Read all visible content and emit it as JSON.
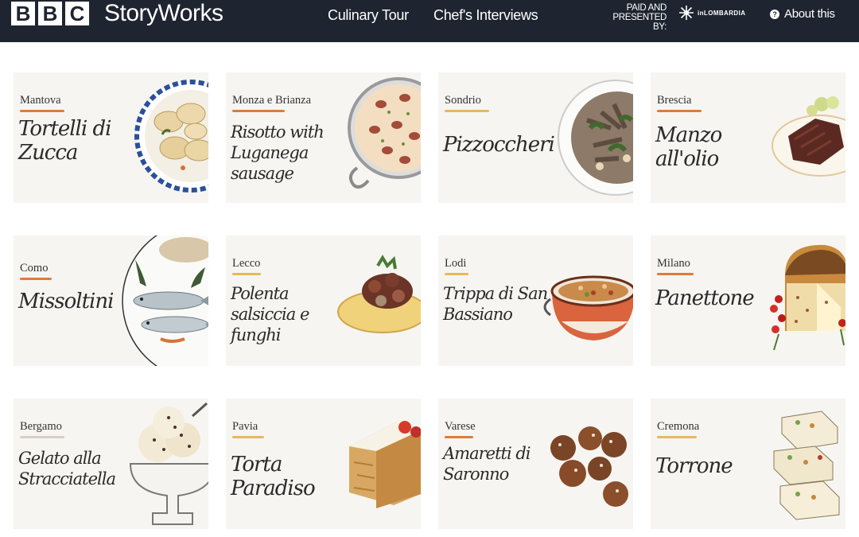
{
  "header": {
    "logo_letters": [
      "B",
      "B",
      "C"
    ],
    "brand": "StoryWorks",
    "nav": [
      "Culinary Tour",
      "Chef's Interviews"
    ],
    "paid_by": "PAID AND PRESENTED BY:",
    "sponsor": "inLOMBARDIA",
    "about": "About this"
  },
  "cards": [
    {
      "region": "Mantova",
      "dish": "Tortelli di Zucca",
      "accent": "#e07a3a"
    },
    {
      "region": "Monza e Brianza",
      "dish": "Risotto with Luganega sausage",
      "accent": "#e07a3a"
    },
    {
      "region": "Sondrio",
      "dish": "Pizzoccheri",
      "accent": "#e8b85a"
    },
    {
      "region": "Brescia",
      "dish": "Manzo all'olio",
      "accent": "#e07a3a"
    },
    {
      "region": "Como",
      "dish": "Missoltini",
      "accent": "#e07a3a"
    },
    {
      "region": "Lecco",
      "dish": "Polenta salsiccia e funghi",
      "accent": "#e8b85a"
    },
    {
      "region": "Lodi",
      "dish": "Trippa di San Bassiano",
      "accent": "#e8b85a"
    },
    {
      "region": "Milano",
      "dish": "Panettone",
      "accent": "#e07a3a"
    },
    {
      "region": "Bergamo",
      "dish": "Gelato alla Stracciatella",
      "accent": "#d9cfc6"
    },
    {
      "region": "Pavia",
      "dish": "Torta Paradiso",
      "accent": "#e8b85a"
    },
    {
      "region": "Varese",
      "dish": "Amaretti di Saronno",
      "accent": "#e07a3a"
    },
    {
      "region": "Cremona",
      "dish": "Torrone",
      "accent": "#e8b85a"
    }
  ]
}
